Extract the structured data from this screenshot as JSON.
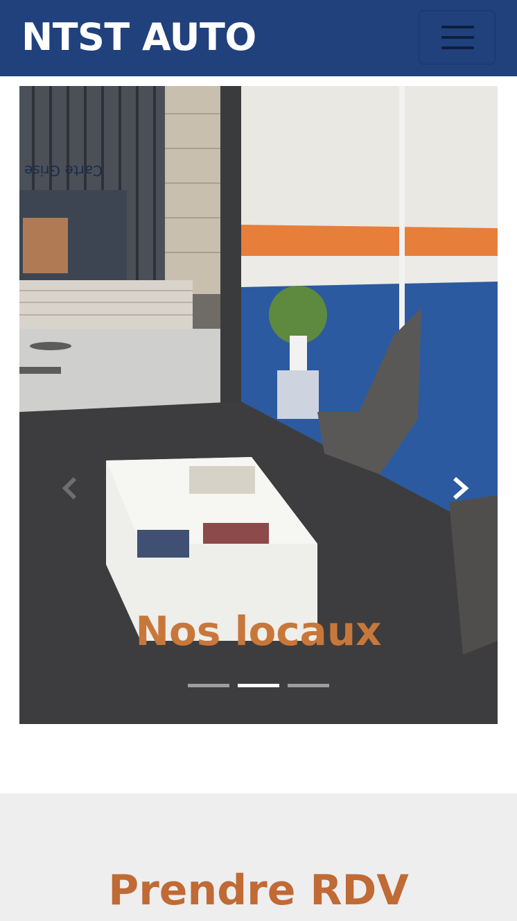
{
  "header": {
    "brand": "NTST AUTO",
    "menu_icon": "hamburger-menu-icon"
  },
  "carousel": {
    "caption": "Nos locaux",
    "slide_count": 3,
    "active_slide": 2,
    "prev_icon": "chevron-left-icon",
    "next_icon": "chevron-right-icon",
    "photo_sign_text": "Carte Grise"
  },
  "section": {
    "title": "Prendre RDV"
  },
  "colors": {
    "navbar": "#20417c",
    "accent": "#c8773a",
    "section_bg": "#eeeeee"
  }
}
